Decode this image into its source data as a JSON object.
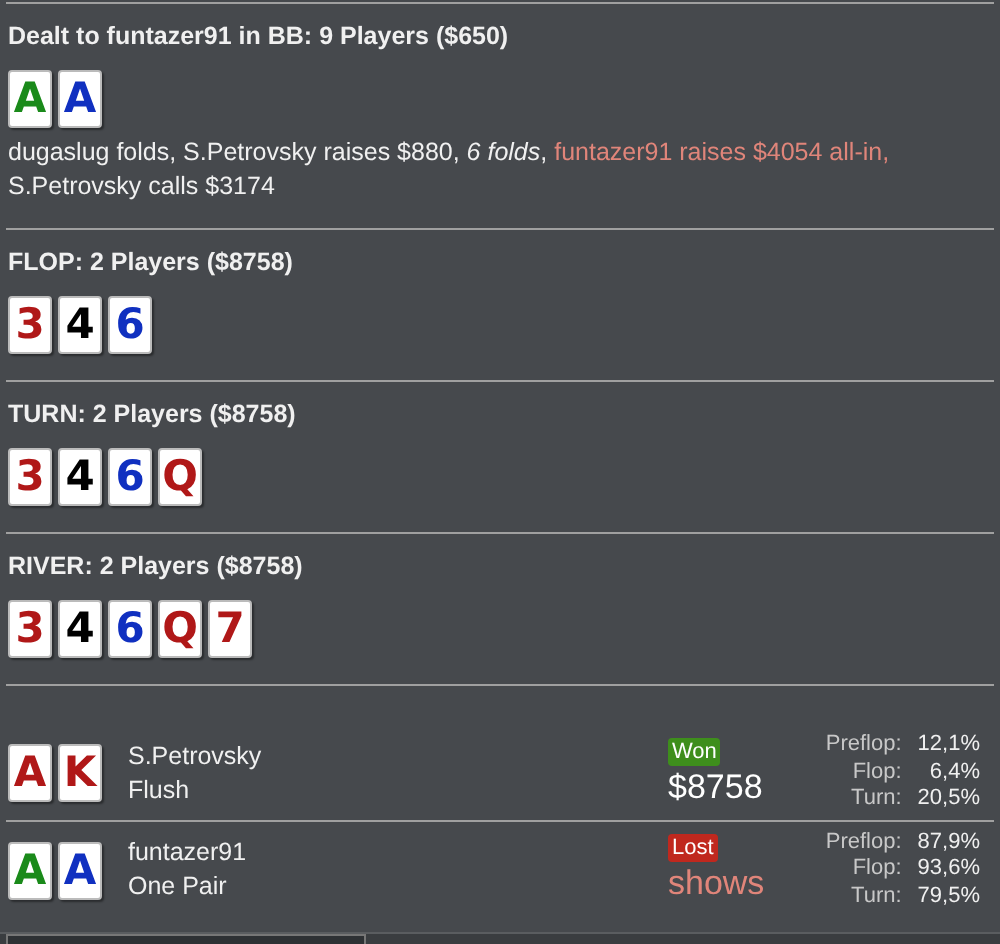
{
  "streets": [
    {
      "title": "Dealt to funtazer91 in BB: 9 Players ($650)",
      "cards": [
        {
          "rank": "A",
          "color": "#1a8a1a"
        },
        {
          "rank": "A",
          "color": "#1030c0"
        }
      ],
      "actions": [
        {
          "kind": "normal",
          "text": "dugaslug folds, S.Petrovsky raises $880, "
        },
        {
          "kind": "italic",
          "text": "6 folds"
        },
        {
          "kind": "normal",
          "text": ", "
        },
        {
          "kind": "hero",
          "text": "funtazer91 raises $4054 all-in,"
        },
        {
          "kind": "normal",
          "text": " S.Petrovsky calls $3174"
        }
      ]
    },
    {
      "title": "FLOP: 2 Players ($8758)",
      "cards": [
        {
          "rank": "3",
          "color": "#b01818"
        },
        {
          "rank": "4",
          "color": "#000000"
        },
        {
          "rank": "6",
          "color": "#1030c0"
        }
      ]
    },
    {
      "title": "TURN: 2 Players ($8758)",
      "cards": [
        {
          "rank": "3",
          "color": "#b01818"
        },
        {
          "rank": "4",
          "color": "#000000"
        },
        {
          "rank": "6",
          "color": "#1030c0"
        },
        {
          "rank": "Q",
          "color": "#b01818"
        }
      ]
    },
    {
      "title": "RIVER: 2 Players ($8758)",
      "cards": [
        {
          "rank": "3",
          "color": "#b01818"
        },
        {
          "rank": "4",
          "color": "#000000"
        },
        {
          "rank": "6",
          "color": "#1030c0"
        },
        {
          "rank": "Q",
          "color": "#b01818"
        },
        {
          "rank": "7",
          "color": "#b01818"
        }
      ]
    }
  ],
  "players": [
    {
      "name": "S.Petrovsky",
      "hand": "Flush",
      "cards": [
        {
          "rank": "A",
          "color": "#b01818"
        },
        {
          "rank": "K",
          "color": "#b01818"
        }
      ],
      "result": {
        "kind": "won",
        "label": "Won"
      },
      "amount": "$8758",
      "stats": [
        {
          "label": "Preflop:",
          "value": "12,1%"
        },
        {
          "label": "Flop:",
          "value": "6,4%"
        },
        {
          "label": "Turn:",
          "value": "20,5%"
        }
      ]
    },
    {
      "name": "funtazer91",
      "hand": "One Pair",
      "cards": [
        {
          "rank": "A",
          "color": "#1a8a1a"
        },
        {
          "rank": "A",
          "color": "#1030c0"
        }
      ],
      "result": {
        "kind": "lost",
        "label": "Lost"
      },
      "amount": "shows",
      "stats": [
        {
          "label": "Preflop:",
          "value": "87,9%"
        },
        {
          "label": "Flop:",
          "value": "93,6%"
        },
        {
          "label": "Turn:",
          "value": "79,5%"
        }
      ]
    }
  ]
}
